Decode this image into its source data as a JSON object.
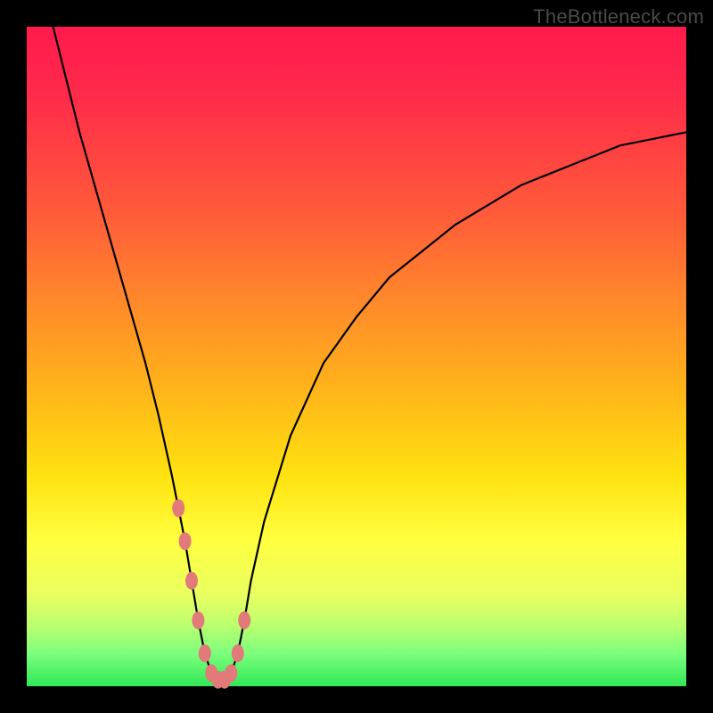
{
  "watermark": "TheBottleneck.com",
  "chart_data": {
    "type": "line",
    "title": "",
    "xlabel": "",
    "ylabel": "",
    "xlim": [
      0,
      100
    ],
    "ylim": [
      0,
      100
    ],
    "series": [
      {
        "name": "bottleneck-curve",
        "x": [
          4,
          6,
          8,
          10,
          12,
          14,
          16,
          18,
          20,
          22,
          23,
          24,
          25,
          26,
          27,
          28,
          29,
          30,
          31,
          32,
          33,
          34,
          36,
          40,
          45,
          50,
          55,
          60,
          65,
          70,
          75,
          80,
          85,
          90,
          95,
          100
        ],
        "y": [
          100,
          92,
          84,
          77,
          70,
          63,
          56,
          49,
          41,
          32,
          27,
          22,
          16,
          10,
          5,
          2,
          1,
          1,
          2,
          5,
          10,
          16,
          25,
          38,
          49,
          56,
          62,
          66,
          70,
          73,
          76,
          78,
          80,
          82,
          83,
          84
        ]
      }
    ],
    "markers": {
      "name": "highlight-points",
      "x": [
        23,
        24,
        25,
        26,
        27,
        28,
        29,
        30,
        31,
        32,
        33
      ],
      "y": [
        27,
        22,
        16,
        10,
        5,
        2,
        1,
        1,
        2,
        5,
        10
      ]
    },
    "background_gradient": {
      "top": "#ff1a4d",
      "mid": "#ffe210",
      "bottom": "#30e858"
    }
  }
}
